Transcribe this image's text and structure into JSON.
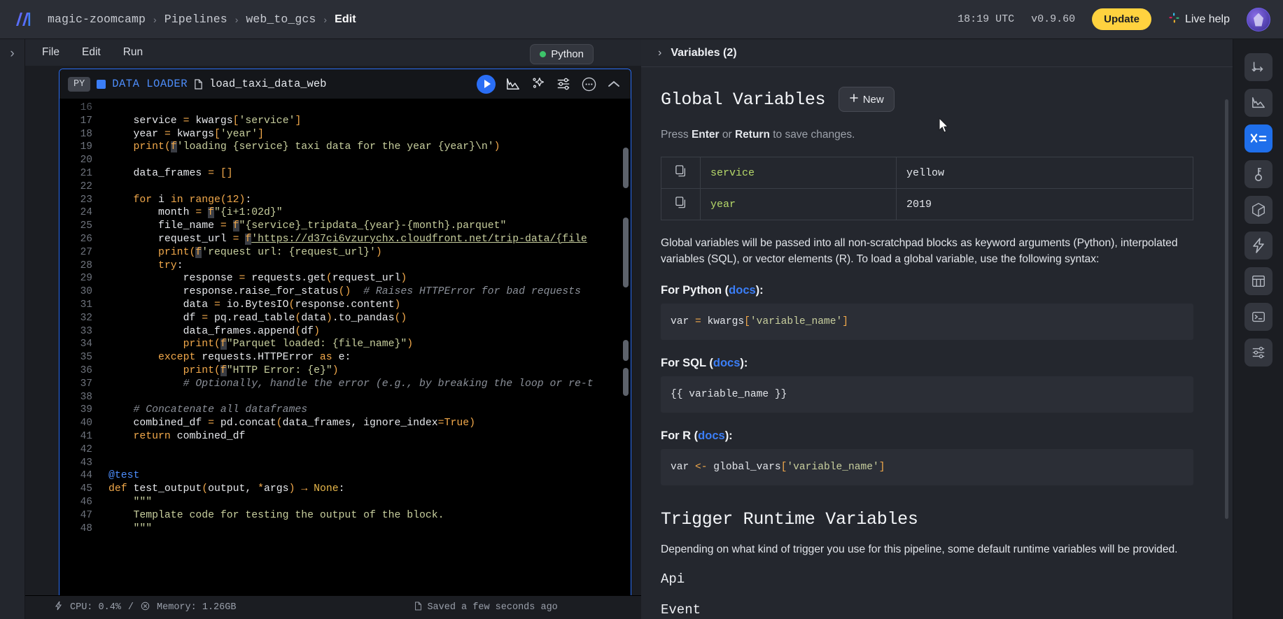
{
  "topbar": {
    "logo_icon": "mage-logo-icon",
    "breadcrumbs": [
      {
        "label": "magic-zoomcamp",
        "active": false
      },
      {
        "label": "Pipelines",
        "active": false
      },
      {
        "label": "web_to_gcs",
        "active": false
      },
      {
        "label": "Edit",
        "active": true
      }
    ],
    "separator": "›",
    "clock": "18:19 UTC",
    "version": "v0.9.60",
    "update_label": "Update",
    "live_help_label": "Live help",
    "slack_icon": "slack-icon",
    "avatar_icon": "user-avatar",
    "accent_yellow": "#ffd23f"
  },
  "leftrail": {
    "expand_icon": "›"
  },
  "menubar": {
    "items": [
      "File",
      "Edit",
      "Run"
    ],
    "language_badge": "Python",
    "language_status_color": "#3dc46a"
  },
  "block": {
    "lang_pill": "PY",
    "type_label": "DATA LOADER",
    "file_icon": "file-icon",
    "name": "load_taxi_data_web",
    "tools": [
      {
        "name": "run-block-button",
        "icon": "play-icon"
      },
      {
        "name": "chart-button",
        "icon": "chart-icon"
      },
      {
        "name": "ai-sparkle-button",
        "icon": "sparkle-icon"
      },
      {
        "name": "settings-sliders-button",
        "icon": "sliders-icon"
      },
      {
        "name": "more-options-button",
        "icon": "ellipsis-circle-icon"
      },
      {
        "name": "collapse-block-button",
        "icon": "chevron-up-icon"
      }
    ]
  },
  "code": {
    "first_partial_line": "16",
    "lines": [
      {
        "n": "17",
        "html": "    <span class='plain'>service </span><span class='pun'>=</span><span class='plain'> kwargs</span><span class='pun'>[</span><span class='str'>'service'</span><span class='pun'>]</span>"
      },
      {
        "n": "18",
        "html": "    <span class='plain'>year </span><span class='pun'>=</span><span class='plain'> kwargs</span><span class='pun'>[</span><span class='str'>'year'</span><span class='pun'>]</span>"
      },
      {
        "n": "19",
        "html": "    <span class='kw'>print</span><span class='pun'>(</span><span class='fstr'>f</span><span class='str'>'loading {service} taxi data for the year {year}\\n'</span><span class='pun'>)</span>"
      },
      {
        "n": "20",
        "html": ""
      },
      {
        "n": "21",
        "html": "    <span class='plain'>data_frames </span><span class='pun'>=</span> <span class='pun'>[]</span>"
      },
      {
        "n": "22",
        "html": ""
      },
      {
        "n": "23",
        "html": "    <span class='kw'>for</span><span class='plain'> i </span><span class='kw'>in</span><span class='kw'> range</span><span class='pun'>(</span><span class='num'>12</span><span class='pun'>)</span><span class='plain'>:</span>"
      },
      {
        "n": "24",
        "html": "        <span class='plain'>month </span><span class='pun'>=</span> <span class='fstr'>f</span><span class='str'>\"{i+1:02d}\"</span>"
      },
      {
        "n": "25",
        "html": "        <span class='plain'>file_name </span><span class='pun'>=</span> <span class='fstr'>f</span><span class='str'>\"{service}_tripdata_{year}-{month}.parquet\"</span>"
      },
      {
        "n": "26",
        "html": "        <span class='plain'>request_url </span><span class='pun'>=</span> <span class='fstr'>f</span><span class='link'>'https://d37ci6vzurychx.cloudfront.net/trip-data/{file</span>"
      },
      {
        "n": "27",
        "html": "        <span class='kw'>print</span><span class='pun'>(</span><span class='fstr'>f</span><span class='str'>'request url: {request_url}'</span><span class='pun'>)</span>"
      },
      {
        "n": "28",
        "html": "        <span class='kw'>try</span><span class='plain'>:</span>"
      },
      {
        "n": "29",
        "html": "            <span class='plain'>response </span><span class='pun'>=</span><span class='plain'> requests.get</span><span class='pun'>(</span><span class='plain'>request_url</span><span class='pun'>)</span>"
      },
      {
        "n": "30",
        "html": "            <span class='plain'>response.raise_for_status</span><span class='pun'>()</span>  <span class='cmt'># Raises HTTPError for bad requests</span>"
      },
      {
        "n": "31",
        "html": "            <span class='plain'>data </span><span class='pun'>=</span><span class='plain'> io.BytesIO</span><span class='pun'>(</span><span class='plain'>response.content</span><span class='pun'>)</span>"
      },
      {
        "n": "32",
        "html": "            <span class='plain'>df </span><span class='pun'>=</span><span class='plain'> pq.read_table</span><span class='pun'>(</span><span class='plain'>data</span><span class='pun'>)</span><span class='plain'>.to_pandas</span><span class='pun'>()</span>"
      },
      {
        "n": "33",
        "html": "            <span class='plain'>data_frames.append</span><span class='pun'>(</span><span class='plain'>df</span><span class='pun'>)</span>"
      },
      {
        "n": "34",
        "html": "            <span class='kw'>print</span><span class='pun'>(</span><span class='fstr'>f</span><span class='str'>\"Parquet loaded: {file_name}\"</span><span class='pun'>)</span>"
      },
      {
        "n": "35",
        "html": "        <span class='kw'>except</span><span class='plain'> requests.HTTPError </span><span class='kw'>as</span><span class='plain'> e:</span>"
      },
      {
        "n": "36",
        "html": "            <span class='kw'>print</span><span class='pun'>(</span><span class='fstr'>f</span><span class='str'>\"HTTP Error: {e}\"</span><span class='pun'>)</span>"
      },
      {
        "n": "37",
        "html": "            <span class='cmt'># Optionally, handle the error (e.g., by breaking the loop or re-t</span>"
      },
      {
        "n": "38",
        "html": ""
      },
      {
        "n": "39",
        "html": "    <span class='cmt'># Concatenate all dataframes</span>"
      },
      {
        "n": "40",
        "html": "    <span class='plain'>combined_df </span><span class='pun'>=</span><span class='plain'> pd.concat</span><span class='pun'>(</span><span class='plain'>data_frames, ignore_index</span><span class='pun'>=</span><span class='kw'>True</span><span class='pun'>)</span>"
      },
      {
        "n": "41",
        "html": "    <span class='kw'>return</span><span class='plain'> combined_df</span>"
      },
      {
        "n": "42",
        "html": ""
      },
      {
        "n": "43",
        "html": ""
      },
      {
        "n": "44",
        "html": "<span class='dec'>@test</span>"
      },
      {
        "n": "45",
        "html": "<span class='kw'>def</span><span class='plain'> test_output</span><span class='pun'>(</span><span class='plain'>output, </span><span class='pun'>*</span><span class='plain'>args</span><span class='pun'>)</span> <span class='pun'>→</span> <span class='kw2'>None</span><span class='plain'>:</span>"
      },
      {
        "n": "46",
        "html": "    <span class='str'>\"\"\"</span>"
      },
      {
        "n": "47",
        "html": "    <span class='str'>Template code for testing the output of the block.</span>"
      },
      {
        "n": "48",
        "html": "    <span class='str'>\"\"\"</span>"
      }
    ]
  },
  "statusbar": {
    "cpu_icon": "bolt-icon",
    "cpu": "CPU: 0.4%",
    "divider": "/",
    "memory_icon": "memory-icon",
    "memory": "Memory: 1.26GB",
    "saved_icon": "file-icon",
    "saved": "Saved a few seconds ago"
  },
  "panel": {
    "header_label": "Variables (2)",
    "header_chevron": "›",
    "title": "Global Variables",
    "new_button": "New",
    "new_button_icon": "plus-icon",
    "hint_prefix": "Press ",
    "hint_enter": "Enter",
    "hint_mid": " or ",
    "hint_return": "Return",
    "hint_suffix": " to save changes.",
    "variables": [
      {
        "copy_icon": "copy-icon",
        "key": "service",
        "value": "yellow"
      },
      {
        "copy_icon": "copy-icon",
        "key": "year",
        "value": "2019"
      }
    ],
    "description": "Global variables will be passed into all non-scratchpad blocks as keyword arguments (Python), interpolated variables (SQL), or vector elements (R). To load a global variable, use the following syntax:",
    "sections": [
      {
        "prefix": "For Python (",
        "link": "docs",
        "suffix": "):",
        "code_html": "<span style='color:#e2e5ea'>var </span><span style='color:#f2a94b'>=</span><span style='color:#e2e5ea'> kwargs</span><span style='color:#f2a94b'>[</span><span style='color:#c8cf9e'>'variable_name'</span><span style='color:#f2a94b'>]</span>"
      },
      {
        "prefix": "For SQL (",
        "link": "docs",
        "suffix": "):",
        "code_html": "<span style='color:#e2e5ea'>{{ variable_name }}</span>"
      },
      {
        "prefix": "For R (",
        "link": "docs",
        "suffix": "):",
        "code_html": "<span style='color:#e2e5ea'>var </span><span style='color:#f2a94b'>&lt;-</span><span style='color:#e2e5ea'> global_vars</span><span style='color:#f2a94b'>[</span><span style='color:#c8cf9e'>'variable_name'</span><span style='color:#f2a94b'>]</span>"
      }
    ],
    "trigger_title": "Trigger Runtime Variables",
    "trigger_desc": "Depending on what kind of trigger you use for this pipeline, some default runtime variables will be provided.",
    "trigger_items": [
      "Api",
      "Event"
    ]
  },
  "iconrail": [
    {
      "name": "tree-branch-icon",
      "active": false
    },
    {
      "name": "chart-area-icon",
      "active": false
    },
    {
      "name": "variables-icon",
      "active": true,
      "glyph": "x="
    },
    {
      "name": "key-icon",
      "active": false
    },
    {
      "name": "cube-icon",
      "active": false
    },
    {
      "name": "lightning-icon",
      "active": false
    },
    {
      "name": "table-icon",
      "active": false
    },
    {
      "name": "terminal-icon",
      "active": false
    },
    {
      "name": "sliders-icon",
      "active": false
    }
  ],
  "cursor": {
    "icon": "mouse-pointer"
  }
}
